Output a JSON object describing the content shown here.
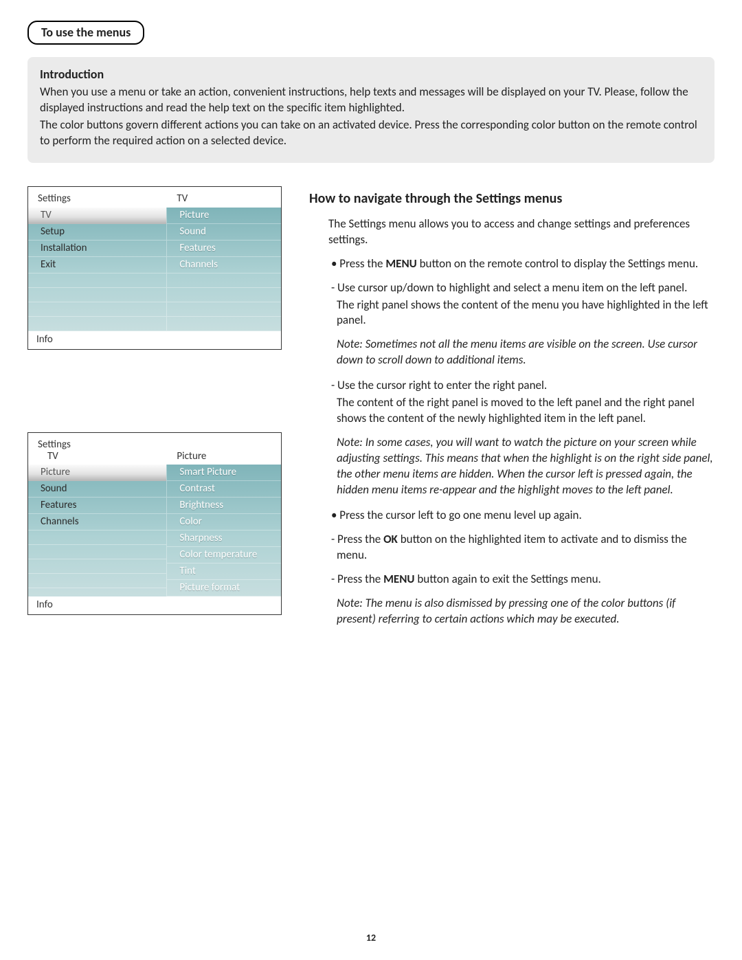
{
  "tab_label": "To use the menus",
  "intro": {
    "heading": "Introduction",
    "p1": "When you use a menu or take an action, convenient instructions, help texts and messages will be displayed on your TV. Please, follow the displayed instructions and read the help text on the specific item highlighted.",
    "p2": "The color buttons govern different actions you can take on an activated device. Press the corresponding color button on the remote control to perform the required action on a selected device."
  },
  "figure1": {
    "header_left": "Settings",
    "header_right": "TV",
    "left_items": [
      "TV",
      "Setup",
      "Installation",
      "Exit"
    ],
    "left_highlight_index": 0,
    "right_items": [
      "Picture",
      "Sound",
      "Features",
      "Channels"
    ],
    "footer": "Info"
  },
  "figure2": {
    "header_left": "Settings",
    "sub_left": "TV",
    "sub_right": "Picture",
    "left_items": [
      "Picture",
      "Sound",
      "Features",
      "Channels"
    ],
    "left_highlight_index": 0,
    "right_items": [
      "Smart Picture",
      "Contrast",
      "Brightness",
      "Color",
      "Sharpness",
      "Color temperature",
      "Tint",
      "Picture format"
    ],
    "footer": "Info"
  },
  "main": {
    "title": "How to navigate through the Settings menus",
    "p1": "The Settings menu allows you to access and change settings and preferences settings.",
    "b1a": "• Press the ",
    "b1_bold": "MENU",
    "b1b": " button on the remote control to display the Settings menu.",
    "b2": "- Use cursor up/down to highlight and select a menu item on the left panel.",
    "b3": "The right panel shows the content of the  menu you have highlighted in the left panel.",
    "note1": "Note: Sometimes not all the menu items are visible on the screen. Use cursor down to scroll down to additional items.",
    "b4": "- Use the cursor right to enter the right panel.",
    "b5": "The content of the right panel is moved to the left panel and the right panel shows the content of the newly highlighted item in the left panel.",
    "note2": "Note: In some cases, you will want to watch the picture on your screen while adjusting settings. This means that when the highlight is on the right side panel, the other menu items are hidden. When the cursor left is pressed again, the hidden menu items re-appear and the highlight moves to the left panel.",
    "b6": "• Press the cursor left to go one menu level up again.",
    "b7a": "- Press the ",
    "b7_bold": "OK",
    "b7b": " button on the highlighted item to activate and to dismiss the menu.",
    "b8a": "- Press the ",
    "b8_bold": "MENU",
    "b8b": " button again to exit the Settings menu.",
    "note3": "Note: The menu is also dismissed by pressing one of the color buttons (if present) referring to certain actions which may be executed."
  },
  "page_number": "12"
}
